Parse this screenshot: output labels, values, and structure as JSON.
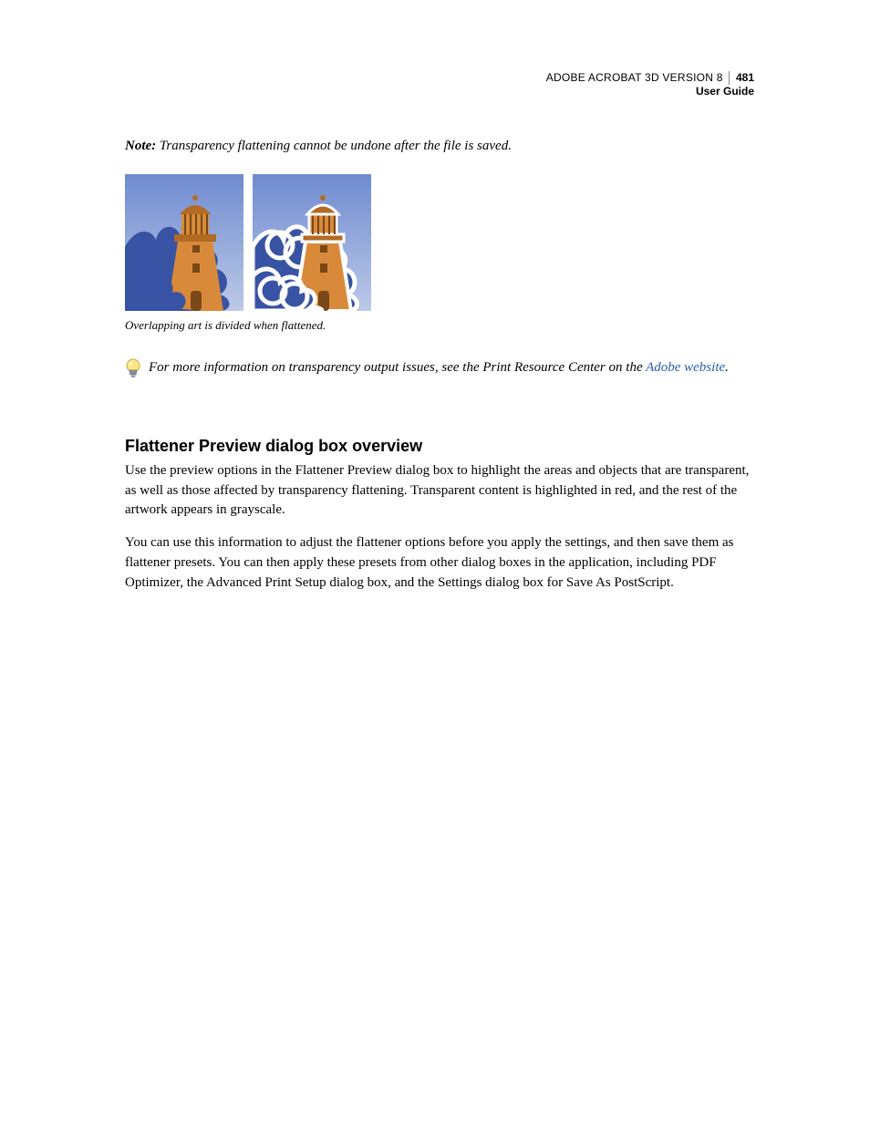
{
  "header": {
    "product": "ADOBE ACROBAT 3D VERSION 8",
    "doc": "User Guide",
    "page_number": "481"
  },
  "note": {
    "label": "Note:",
    "text": "Transparency flattening cannot be undone after the file is saved."
  },
  "figure": {
    "caption": "Overlapping art is divided when flattened."
  },
  "tip": {
    "text_before_link": "For more information on transparency output issues, see the Print Resource Center on the ",
    "link_text": "Adobe website",
    "text_after_link": "."
  },
  "section": {
    "heading": "Flattener Preview dialog box overview",
    "para1": "Use the preview options in the Flattener Preview dialog box to highlight the areas and objects that are transparent, as well as those affected by transparency flattening. Transparent content is highlighted in red, and the rest of the artwork appears in grayscale.",
    "para2": "You can use this information to adjust the flattener options before you apply the settings, and then save them as flattener presets. You can then apply these presets from other dialog boxes in the application, including PDF Optimizer, the Advanced Print Setup dialog box, and the Settings dialog box for Save As PostScript."
  }
}
